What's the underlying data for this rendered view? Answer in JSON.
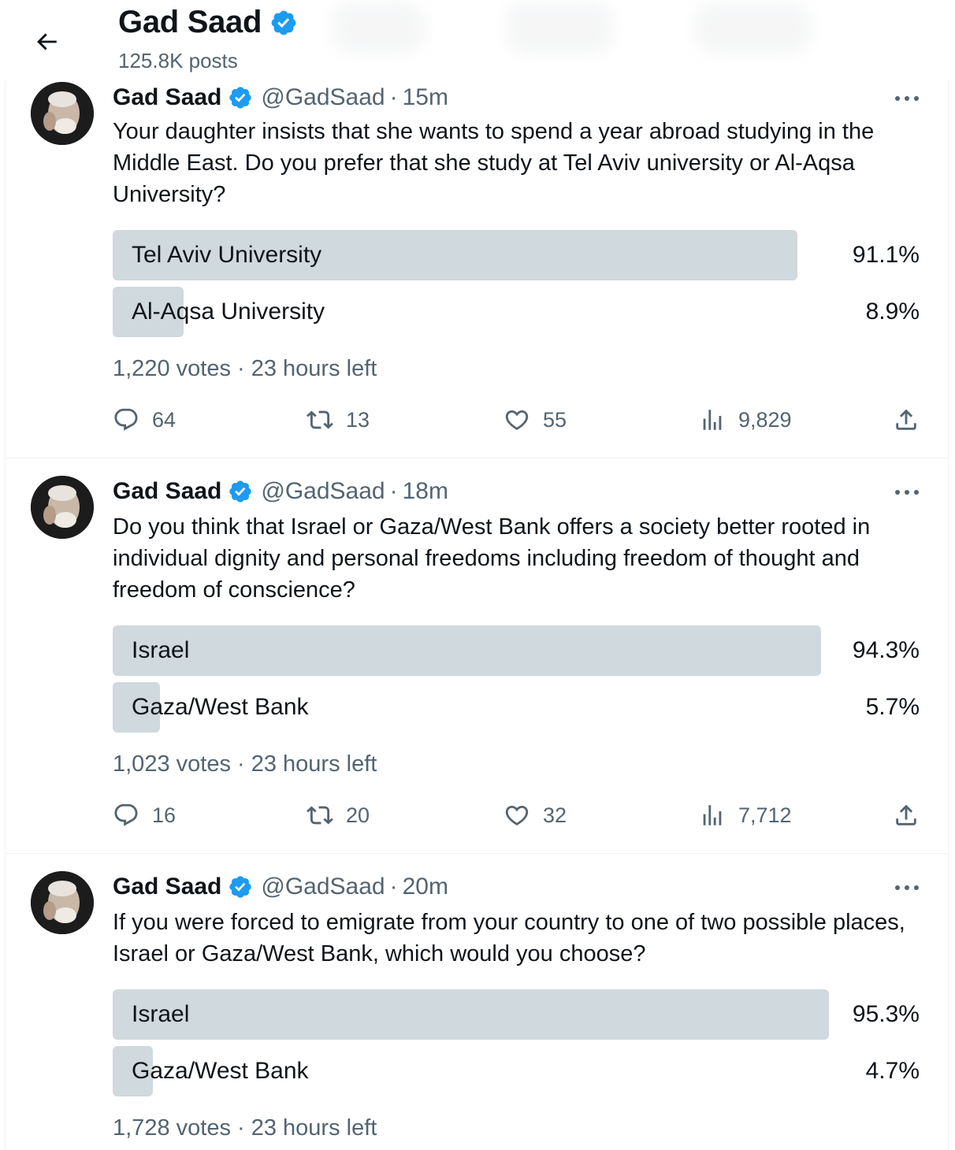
{
  "header": {
    "title": "Gad Saad",
    "subtitle": "125.8K posts"
  },
  "colors": {
    "verified": "#1d9bf0",
    "poll_fill": "#cfd9de",
    "secondary_text": "#536471"
  },
  "tweets": [
    {
      "name": "Gad Saad",
      "handle": "@GadSaad",
      "dot": "·",
      "time": "15m",
      "text": "Your daughter insists that she wants to spend a year abroad studying in the Middle East.  Do you prefer that she study at Tel Aviv university or Al-Aqsa University?",
      "poll": {
        "options": [
          {
            "label": "Tel Aviv University",
            "percent": "91.1%",
            "value": 91.1
          },
          {
            "label": "Al-Aqsa University",
            "percent": "8.9%",
            "value": 8.9
          }
        ],
        "meta": "1,220 votes · 23 hours left"
      },
      "actions": {
        "replies": "64",
        "reposts": "13",
        "likes": "55",
        "views": "9,829"
      }
    },
    {
      "name": "Gad Saad",
      "handle": "@GadSaad",
      "dot": "·",
      "time": "18m",
      "text": "Do you think that Israel or Gaza/West Bank offers a society better rooted in individual dignity and personal freedoms including freedom of thought and freedom of conscience?",
      "poll": {
        "options": [
          {
            "label": "Israel",
            "percent": "94.3%",
            "value": 94.3
          },
          {
            "label": "Gaza/West Bank",
            "percent": "5.7%",
            "value": 5.7
          }
        ],
        "meta": "1,023 votes · 23 hours left"
      },
      "actions": {
        "replies": "16",
        "reposts": "20",
        "likes": "32",
        "views": "7,712"
      }
    },
    {
      "name": "Gad Saad",
      "handle": "@GadSaad",
      "dot": "·",
      "time": "20m",
      "text": "If you were forced to emigrate from your country to one of two possible places, Israel or Gaza/West Bank, which would you choose?",
      "poll": {
        "options": [
          {
            "label": "Israel",
            "percent": "95.3%",
            "value": 95.3
          },
          {
            "label": "Gaza/West Bank",
            "percent": "4.7%",
            "value": 4.7
          }
        ],
        "meta": "1,728 votes · 23 hours left"
      }
    }
  ]
}
